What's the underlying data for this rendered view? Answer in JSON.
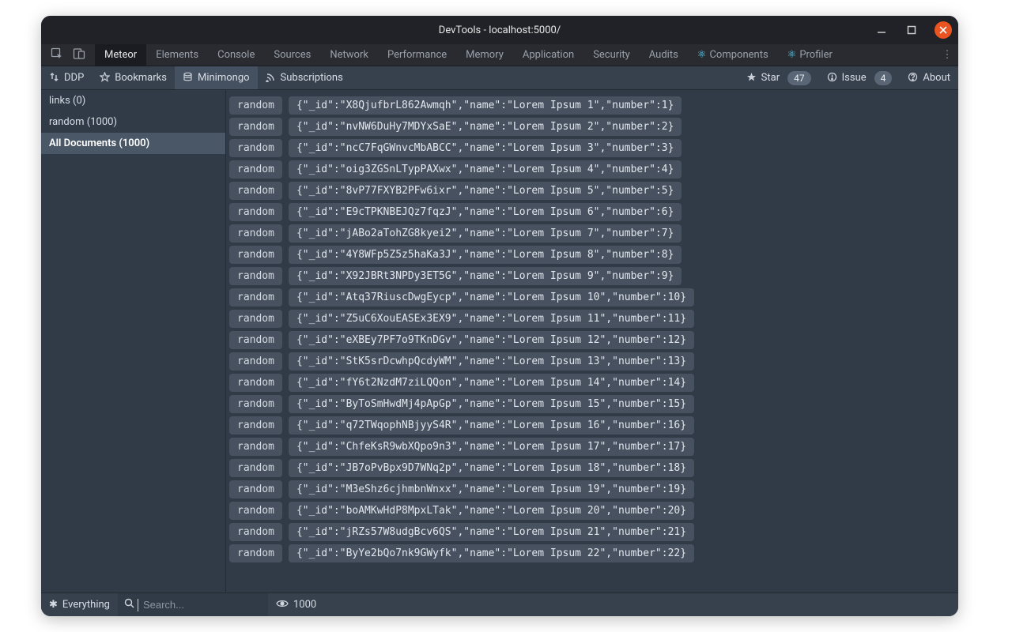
{
  "window": {
    "title": "DevTools - localhost:5000/"
  },
  "tabs": {
    "items": [
      {
        "label": "Meteor",
        "active": true
      },
      {
        "label": "Elements"
      },
      {
        "label": "Console"
      },
      {
        "label": "Sources"
      },
      {
        "label": "Network"
      },
      {
        "label": "Performance"
      },
      {
        "label": "Memory"
      },
      {
        "label": "Application"
      },
      {
        "label": "Security"
      },
      {
        "label": "Audits"
      },
      {
        "label": "Components",
        "react": true
      },
      {
        "label": "Profiler",
        "react": true
      }
    ]
  },
  "subnav": {
    "left": [
      {
        "label": "DDP",
        "icon": "updown"
      },
      {
        "label": "Bookmarks",
        "icon": "star"
      },
      {
        "label": "Minimongo",
        "icon": "db",
        "active": true
      },
      {
        "label": "Subscriptions",
        "icon": "feed"
      }
    ],
    "right": [
      {
        "label": "Star",
        "icon": "starfill",
        "badge": "47"
      },
      {
        "label": "Issue",
        "icon": "issue",
        "badge": "4"
      },
      {
        "label": "About",
        "icon": "help"
      }
    ]
  },
  "sidebar": {
    "items": [
      {
        "label": "links (0)"
      },
      {
        "label": "random (1000)"
      },
      {
        "label": "All Documents (1000)",
        "active": true
      }
    ]
  },
  "footer": {
    "filter_label": "Everything",
    "search_placeholder": "Search...",
    "visible_count": "1000"
  },
  "docs": {
    "collection_tag": "random",
    "rows": [
      {
        "_id": "X8QjufbrL862Awmqh",
        "name": "Lorem Ipsum 1",
        "number": 1
      },
      {
        "_id": "nvNW6DuHy7MDYxSaE",
        "name": "Lorem Ipsum 2",
        "number": 2
      },
      {
        "_id": "ncC7FqGWnvcMbABCC",
        "name": "Lorem Ipsum 3",
        "number": 3
      },
      {
        "_id": "oig3ZGSnLTypPAXwx",
        "name": "Lorem Ipsum 4",
        "number": 4
      },
      {
        "_id": "8vP77FXYB2PFw6ixr",
        "name": "Lorem Ipsum 5",
        "number": 5
      },
      {
        "_id": "E9cTPKNBEJQz7fqzJ",
        "name": "Lorem Ipsum 6",
        "number": 6
      },
      {
        "_id": "jABo2aTohZG8kyei2",
        "name": "Lorem Ipsum 7",
        "number": 7
      },
      {
        "_id": "4Y8WFp5Z5z5haKa3J",
        "name": "Lorem Ipsum 8",
        "number": 8
      },
      {
        "_id": "X92JBRt3NPDy3ET5G",
        "name": "Lorem Ipsum 9",
        "number": 9
      },
      {
        "_id": "Atq37RiuscDwgEycp",
        "name": "Lorem Ipsum 10",
        "number": 10
      },
      {
        "_id": "Z5uC6XouEASEx3EX9",
        "name": "Lorem Ipsum 11",
        "number": 11
      },
      {
        "_id": "eXBEy7PF7o9TKnDGv",
        "name": "Lorem Ipsum 12",
        "number": 12
      },
      {
        "_id": "StK5srDcwhpQcdyWM",
        "name": "Lorem Ipsum 13",
        "number": 13
      },
      {
        "_id": "fY6t2NzdM7ziLQQon",
        "name": "Lorem Ipsum 14",
        "number": 14
      },
      {
        "_id": "ByToSmHwdMj4pApGp",
        "name": "Lorem Ipsum 15",
        "number": 15
      },
      {
        "_id": "q72TWqophNBjyyS4R",
        "name": "Lorem Ipsum 16",
        "number": 16
      },
      {
        "_id": "ChfeKsR9wbXQpo9n3",
        "name": "Lorem Ipsum 17",
        "number": 17
      },
      {
        "_id": "JB7oPvBpx9D7WNq2p",
        "name": "Lorem Ipsum 18",
        "number": 18
      },
      {
        "_id": "M3eShz6cjhmbnWnxx",
        "name": "Lorem Ipsum 19",
        "number": 19
      },
      {
        "_id": "boAMKwHdP8MpxLTak",
        "name": "Lorem Ipsum 20",
        "number": 20
      },
      {
        "_id": "jRZs57W8udgBcv6QS",
        "name": "Lorem Ipsum 21",
        "number": 21
      },
      {
        "_id": "ByYe2bQo7nk9GWyfk",
        "name": "Lorem Ipsum 22",
        "number": 22
      }
    ]
  }
}
